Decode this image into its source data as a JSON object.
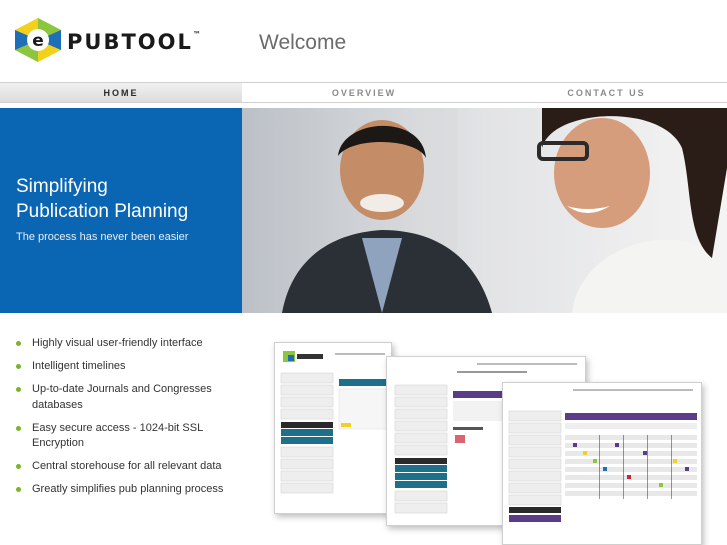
{
  "header": {
    "logo_text": "PUBTOOL",
    "logo_tm": "™",
    "welcome": "Welcome"
  },
  "nav": {
    "items": [
      "HOME",
      "OVERVIEW",
      "CONTACT US"
    ],
    "active": "HOME"
  },
  "hero": {
    "title_line1": "Simplifying",
    "title_line2": "Publication Planning",
    "subtitle": "The process has never been easier"
  },
  "features": [
    "Highly visual user-friendly interface",
    "Intelligent timelines",
    "Up-to-date Journals and Congresses databases",
    "Easy secure access - 1024-bit SSL Encryption",
    "Central storehouse for all relevant data",
    "Greatly simplifies pub planning process"
  ],
  "colors": {
    "brand_blue": "#0a66b3",
    "bullet_green": "#7ab32e",
    "logo_green": "#8cc63f",
    "logo_yellow": "#f3d11a",
    "logo_blue": "#1f6fb8",
    "screen_purple": "#5b3c88",
    "screen_teal": "#1d6f8a"
  },
  "icons": {
    "logo_mark": "epubtool-logo-mark-icon",
    "bullet": "bullet-dot-icon"
  }
}
